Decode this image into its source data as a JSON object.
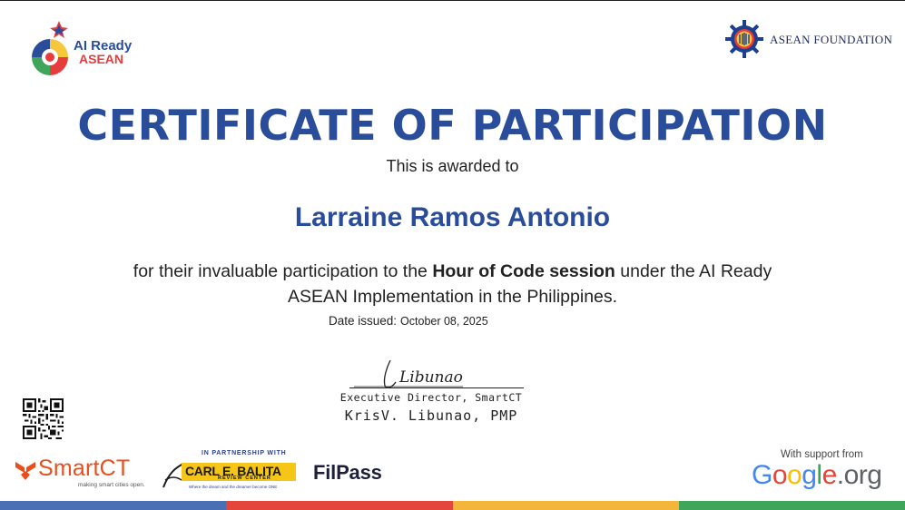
{
  "logos": {
    "ai_ready": {
      "line1": "AI Ready",
      "line2": "ASEAN"
    },
    "asean_foundation": {
      "text": "ASEAN FOUNDATION"
    }
  },
  "certificate": {
    "title": "CERTIFICATE OF PARTICIPATION",
    "awarded_line": "This is awarded to",
    "recipient": "Larraine Ramos Antonio",
    "body_pre": "for their invaluable participation to the ",
    "body_bold": "Hour of Code session",
    "body_post": " under the AI Ready ASEAN Implementation in the Philippines.",
    "date_label": "Date issued:",
    "date_value": "October 08, 2025"
  },
  "signature": {
    "script_text": "Libunao",
    "role": "Executive Director, SmartCT",
    "name": "KrisV. Libunao, PMP"
  },
  "footer": {
    "smartct": {
      "name": "SmartCT",
      "tagline": "making smart cities open."
    },
    "partnership": {
      "caption": "IN PARTNERSHIP WITH",
      "brand": "CARL E. BALITA",
      "brand_sub": "REVIEW CENTER",
      "slogan": "Where the dream and the dreamer become ONE"
    },
    "filpass": {
      "name": "FilPass"
    },
    "google": {
      "caption": "With support from",
      "word": "Google.org"
    }
  },
  "colors": {
    "title_blue": "#2a4d9b",
    "bar": [
      "#4a6fb5",
      "#e5463c",
      "#f4b63a",
      "#3ea55b"
    ],
    "google_letters": [
      "#4285F4",
      "#EA4335",
      "#FBBC05",
      "#4285F4",
      "#34A853",
      "#EA4335",
      "#5f6368",
      "#5f6368",
      "#5f6368",
      "#5f6368"
    ]
  }
}
